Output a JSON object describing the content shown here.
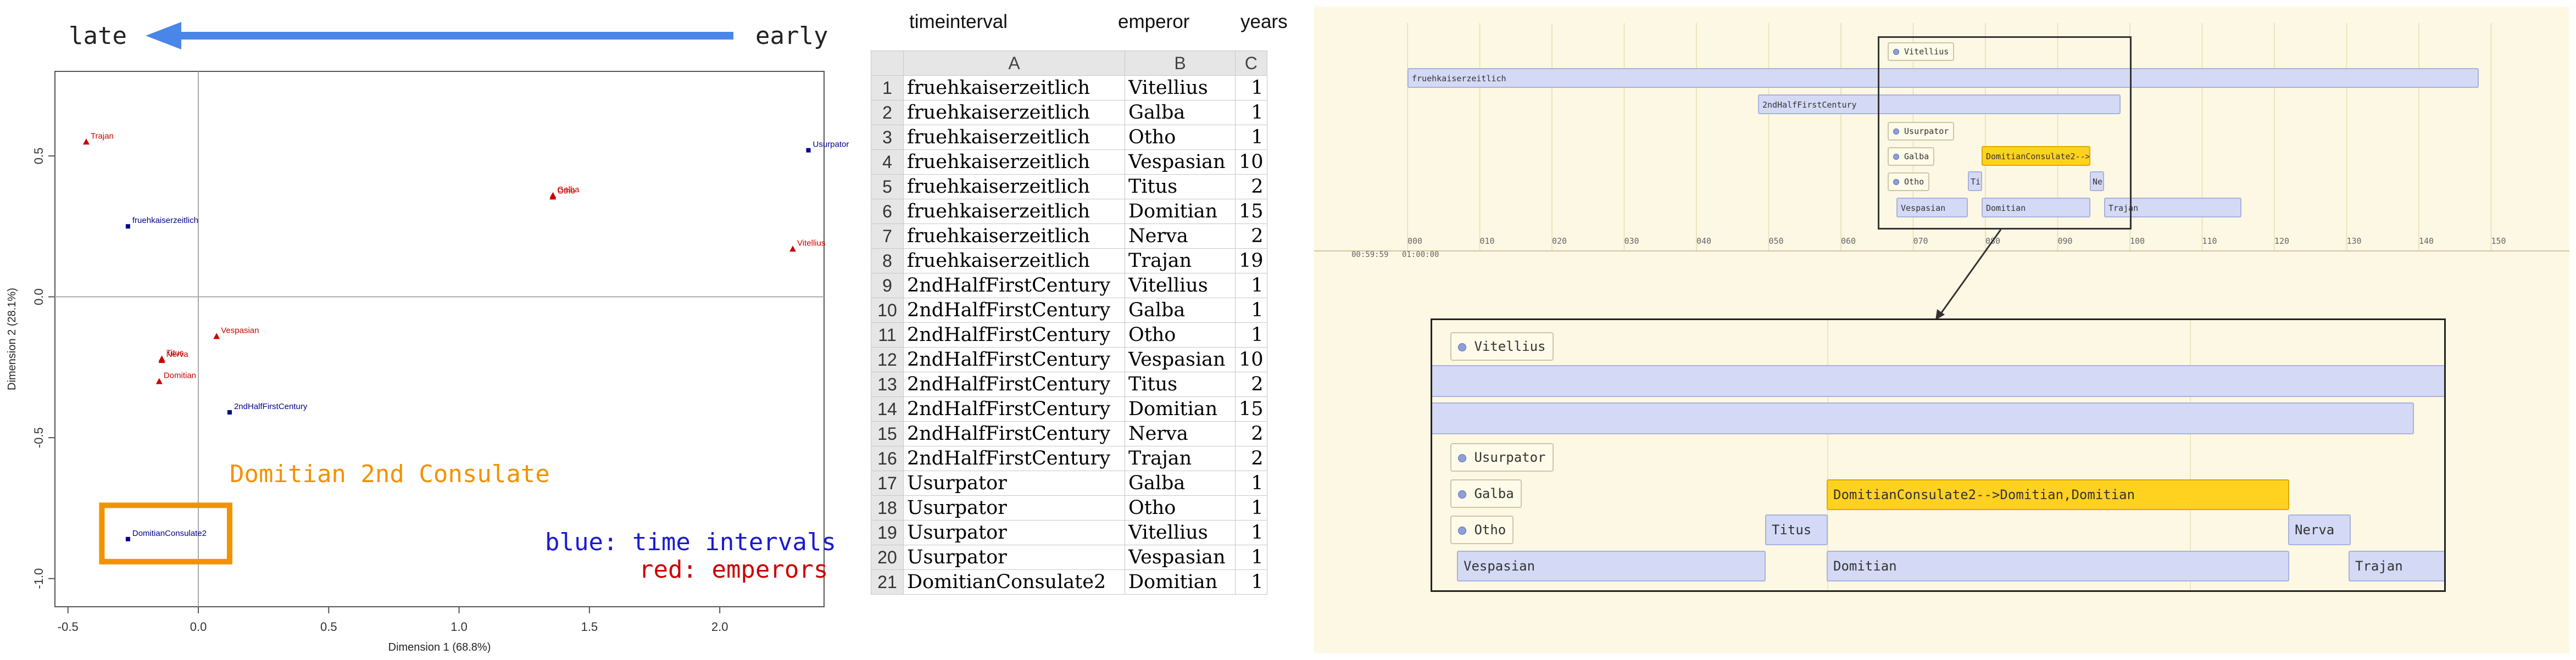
{
  "arrow": {
    "left_label": "late",
    "right_label": "early",
    "color": "#4a86e8"
  },
  "chart_data": {
    "type": "scatter",
    "xlabel": "Dimension 1 (68.8%)",
    "ylabel": "Dimension 2 (28.1%)",
    "xlim": [
      -0.55,
      2.4
    ],
    "ylim": [
      -1.1,
      0.8
    ],
    "xticks": [
      "-0.5",
      "0.0",
      "0.5",
      "1.0",
      "1.5",
      "2.0"
    ],
    "yticks": [
      "-1.0",
      "-0.5",
      "0.0",
      "0.5"
    ],
    "series": [
      {
        "name": "blue: time intervals",
        "color": "#00008b",
        "marker": "square",
        "points": [
          {
            "label": "fruehkaiserzeitlich",
            "x": -0.27,
            "y": 0.25
          },
          {
            "label": "Usurpator",
            "x": 2.34,
            "y": 0.52
          },
          {
            "label": "2ndHalfFirstCentury",
            "x": 0.12,
            "y": -0.41
          },
          {
            "label": "DomitianConsulate2",
            "x": -0.27,
            "y": -0.86
          }
        ]
      },
      {
        "name": "red: emperors",
        "color": "#cc0000",
        "marker": "triangle",
        "points": [
          {
            "label": "Trajan",
            "x": -0.43,
            "y": 0.55
          },
          {
            "label": "Galba",
            "x": 1.36,
            "y": 0.36
          },
          {
            "label": "Otho",
            "x": 1.36,
            "y": 0.355
          },
          {
            "label": "Vitellius",
            "x": 2.28,
            "y": 0.17
          },
          {
            "label": "Vespasian",
            "x": 0.07,
            "y": -0.14
          },
          {
            "label": "Titus",
            "x": -0.14,
            "y": -0.22
          },
          {
            "label": "Nerva",
            "x": -0.14,
            "y": -0.225
          },
          {
            "label": "Domitian",
            "x": -0.15,
            "y": -0.3
          }
        ]
      }
    ],
    "annotation": {
      "text": "Domitian 2nd Consulate",
      "color": "#f39200"
    }
  },
  "legend": {
    "blue": "blue: time intervals",
    "red": "red: emperors"
  },
  "sheet": {
    "headers": [
      "timeinterval",
      "emperor",
      "years"
    ],
    "columns": [
      "A",
      "B",
      "C"
    ],
    "rows": [
      [
        "fruehkaiserzeitlich",
        "Vitellius",
        "1"
      ],
      [
        "fruehkaiserzeitlich",
        "Galba",
        "1"
      ],
      [
        "fruehkaiserzeitlich",
        "Otho",
        "1"
      ],
      [
        "fruehkaiserzeitlich",
        "Vespasian",
        "10"
      ],
      [
        "fruehkaiserzeitlich",
        "Titus",
        "2"
      ],
      [
        "fruehkaiserzeitlich",
        "Domitian",
        "15"
      ],
      [
        "fruehkaiserzeitlich",
        "Nerva",
        "2"
      ],
      [
        "fruehkaiserzeitlich",
        "Trajan",
        "19"
      ],
      [
        "2ndHalfFirstCentury",
        "Vitellius",
        "1"
      ],
      [
        "2ndHalfFirstCentury",
        "Galba",
        "1"
      ],
      [
        "2ndHalfFirstCentury",
        "Otho",
        "1"
      ],
      [
        "2ndHalfFirstCentury",
        "Vespasian",
        "10"
      ],
      [
        "2ndHalfFirstCentury",
        "Titus",
        "2"
      ],
      [
        "2ndHalfFirstCentury",
        "Domitian",
        "15"
      ],
      [
        "2ndHalfFirstCentury",
        "Nerva",
        "2"
      ],
      [
        "2ndHalfFirstCentury",
        "Trajan",
        "2"
      ],
      [
        "Usurpator",
        "Galba",
        "1"
      ],
      [
        "Usurpator",
        "Otho",
        "1"
      ],
      [
        "Usurpator",
        "Vitellius",
        "1"
      ],
      [
        "Usurpator",
        "Vespasian",
        "1"
      ],
      [
        "DomitianConsulate2",
        "Domitian",
        "1"
      ]
    ]
  },
  "timeline": {
    "ticks": [
      "000",
      "010",
      "020",
      "030",
      "040",
      "050",
      "060",
      "070",
      "080",
      "090",
      "100",
      "110",
      "120",
      "130",
      "140",
      "150"
    ],
    "time_labels": [
      "00:59:59",
      "01:00:00"
    ],
    "overview": {
      "points": [
        "Vitellius",
        "Usurpator",
        "Galba",
        "Otho"
      ],
      "bars": [
        "fruehkaiserzeitlich",
        "2ndHalfFirstCentury",
        "DomitianConsulate2-->",
        "Ti",
        "Ne",
        "Vespasian",
        "Domitian",
        "Trajan"
      ]
    },
    "zoom": {
      "points": [
        "Vitellius",
        "Usurpator",
        "Galba",
        "Otho"
      ],
      "bars": [
        "DomitianConsulate2-->Domitian,Domitian",
        "Titus",
        "Nerva",
        "Vespasian",
        "Domitian",
        "Trajan"
      ]
    },
    "colors": {
      "background": "#fcf8e3",
      "bar": "#d4daf5",
      "highlight": "#ffd21f"
    }
  }
}
